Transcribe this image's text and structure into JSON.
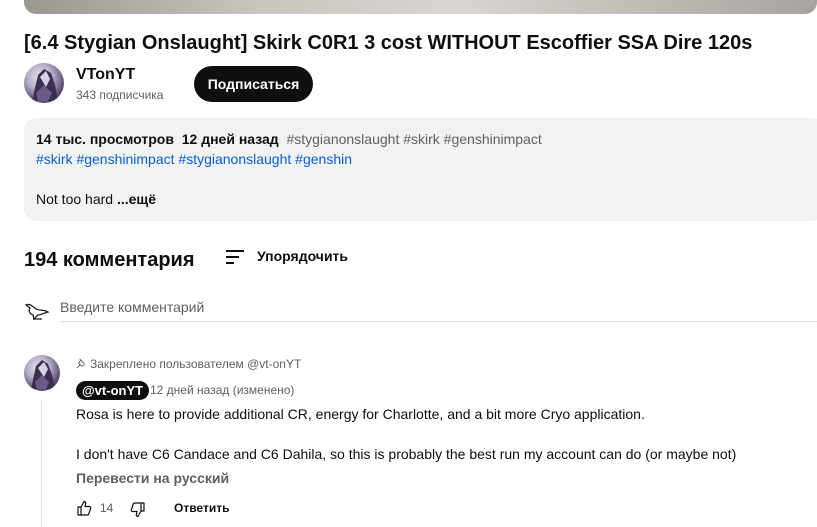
{
  "video": {
    "title": "[6.4 Stygian Onslaught] Skirk C0R1 3 cost WITHOUT Escoffier SSA Dire 120s"
  },
  "channel": {
    "name": "VTonYT",
    "subscribers": "343 подписчика",
    "subscribe_label": "Подписаться"
  },
  "description": {
    "views": "14 тыс. просмотров",
    "date": "12 дней назад",
    "top_tags": "#stygianonslaught #skirk #genshinimpact",
    "tags": [
      "#skirk",
      "#genshinimpact",
      "#stygianonslaught",
      "#genshin"
    ],
    "text": "Not too hard",
    "more_label": "...ещё"
  },
  "comments": {
    "count_label": "194 комментария",
    "sort_label": "Упорядочить",
    "input_placeholder": "Введите комментарий",
    "items": [
      {
        "pinned_label": "Закреплено пользователем @vt-onYT",
        "author": "@vt-onYT",
        "time": "12 дней назад (изменено)",
        "text_lines": [
          "Rosa is here to provide additional CR, energy for Charlotte, and a bit more Cryo application.",
          "I don't have C6 Candace and C6 Dahila, so this is probably the best run my account can do (or maybe not)"
        ],
        "translate_label": "Перевести на русский",
        "likes": "14",
        "reply_label": "Ответить"
      }
    ]
  },
  "icons": {
    "sort": "sort-icon",
    "pin": "pin-icon",
    "like": "thumbs-up-icon",
    "dislike": "thumbs-down-icon"
  },
  "colors": {
    "hashtag": "#065fd4",
    "secondary_text": "#606060",
    "description_bg": "#f2f2f2",
    "subscribe_bg": "#0f0f0f"
  }
}
